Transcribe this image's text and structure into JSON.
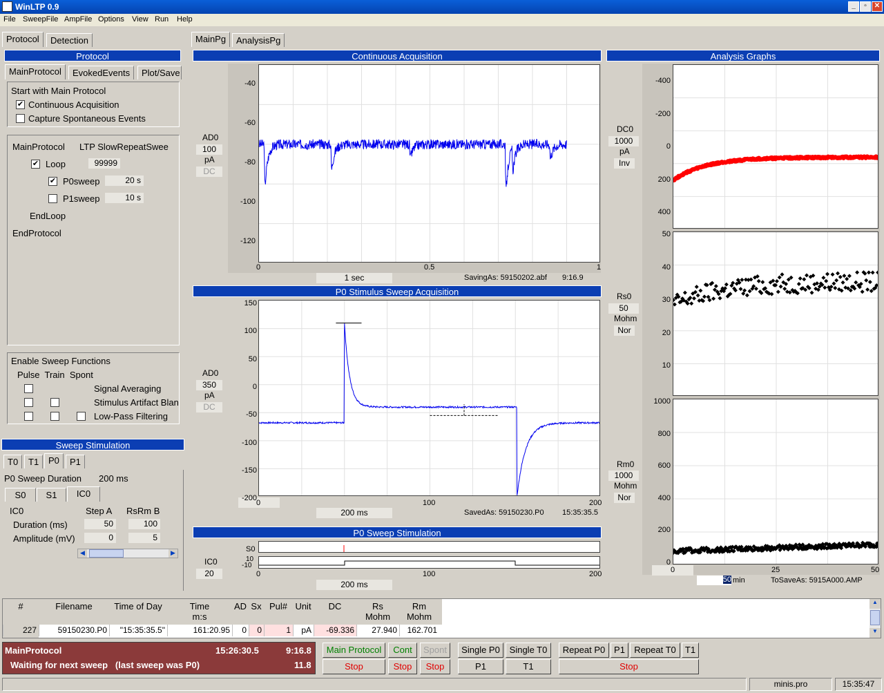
{
  "window": {
    "title": "WinLTP 0.9"
  },
  "menu": [
    "File",
    "SweepFile",
    "AmpFile",
    "Options",
    "View",
    "Run",
    "Help"
  ],
  "left_tabs": [
    "Protocol",
    "Detection"
  ],
  "protocol": {
    "header": "Protocol",
    "subtabs": [
      "MainProtocol",
      "EvokedEvents",
      "Plot/Save"
    ],
    "start_title": "Start with Main Protocol",
    "continuous": "Continuous Acquisition",
    "capture": "Capture Spontaneous Events",
    "main_label": "MainProtocol",
    "main_name": "LTP SlowRepeatSwee",
    "loop": "Loop",
    "loop_count": "99999",
    "p0sweep": "P0sweep",
    "p0_time": "20 s",
    "p1sweep": "P1sweep",
    "p1_time": "10 s",
    "endloop": "EndLoop",
    "endprotocol": "EndProtocol"
  },
  "enable": {
    "title": "Enable Sweep Functions",
    "cols": "Pulse  Train  Spont",
    "rows": [
      "Signal Averaging",
      "Stimulus Artifact Blan",
      "Low-Pass Filtering"
    ]
  },
  "sweep_stim": {
    "header": "Sweep Stimulation",
    "tabs": [
      "T0",
      "T1",
      "P0",
      "P1"
    ],
    "duration_label": "P0 Sweep Duration",
    "duration_val": "200 ms",
    "subtabs": [
      "S0",
      "S1",
      "IC0"
    ],
    "ic0": "IC0",
    "step_a": "Step A",
    "rsrm_b": "RsRm B",
    "dur_label": "Duration (ms)",
    "dur_a": "50",
    "dur_b": "100",
    "amp_label": "Amplitude (mV)",
    "amp_a": "0",
    "amp_b": "5"
  },
  "main_tabs": [
    "MainPg",
    "AnalysisPg"
  ],
  "cont": {
    "header": "Continuous Acquisition",
    "chan": "AD0",
    "scale": "100",
    "unit": "pA",
    "mode": "DC",
    "yticks": [
      "-40",
      "-60",
      "-80",
      "-100",
      "-120"
    ],
    "xticks": [
      "0",
      "0.5",
      "1"
    ],
    "xunit": "1 sec",
    "saving": "SavingAs: 59150202.abf",
    "time": "9:16.9"
  },
  "p0acq": {
    "header": "P0 Stimulus Sweep Acquisition",
    "chan": "AD0",
    "scale": "350",
    "unit": "pA",
    "mode": "DC",
    "yticks": [
      "150",
      "100",
      "50",
      "0",
      "-50",
      "-100",
      "-150",
      "-200"
    ],
    "xticks": [
      "0",
      "100",
      "200"
    ],
    "xunit": "200 ms",
    "saved": "SavedAs: 59150230.P0",
    "time": "15:35:35.5"
  },
  "p0stim": {
    "header": "P0 Sweep Stimulation",
    "s0": "S0",
    "ten": "10",
    "mten": "-10",
    "ic0": "IC0",
    "ic0_val": "20",
    "xticks": [
      "0",
      "100",
      "200"
    ],
    "xunit": "200 ms"
  },
  "analysis": {
    "header": "Analysis Graphs",
    "dc": {
      "chan": "DC0",
      "scale": "1000",
      "unit": "pA",
      "mode": "Inv",
      "yticks": [
        "-400",
        "-200",
        "0",
        "200",
        "400"
      ]
    },
    "rs": {
      "chan": "Rs0",
      "scale": "50",
      "unit": "Mohm",
      "mode": "Nor",
      "yticks": [
        "50",
        "40",
        "30",
        "20",
        "10"
      ]
    },
    "rm": {
      "chan": "Rm0",
      "scale": "1000",
      "unit": "Mohm",
      "mode": "Nor",
      "yticks": [
        "1000",
        "800",
        "600",
        "400",
        "200",
        "0"
      ]
    },
    "xticks": [
      "0",
      "25",
      "50"
    ],
    "xval": "50",
    "xunit": "min",
    "tosave": "ToSaveAs: 5915A000.AMP"
  },
  "table": {
    "headers": [
      [
        "#",
        ""
      ],
      [
        "Filename",
        ""
      ],
      [
        "Time of Day",
        ""
      ],
      [
        "Time",
        "m:s"
      ],
      [
        "AD",
        ""
      ],
      [
        "Sx",
        ""
      ],
      [
        "Pul#",
        ""
      ],
      [
        "Unit",
        ""
      ],
      [
        "DC",
        ""
      ],
      [
        "Rs",
        "Mohm"
      ],
      [
        "Rm",
        "Mohm"
      ]
    ],
    "row": [
      "227",
      "59150230.P0",
      "\"15:35:35.5\"",
      "161:20.95",
      "0",
      "0",
      "1",
      "pA",
      "-69.336",
      "27.940",
      "162.701"
    ]
  },
  "status": {
    "proto": "MainProtocol",
    "clock": "15:26:30.5",
    "elapsed": "9:16.8",
    "waiting": "Waiting for next sweep   (last sweep was P0)",
    "count": "11.8"
  },
  "buttons": {
    "main_protocol": "Main Protocol",
    "cont": "Cont",
    "spont": "Spont",
    "stop": "Stop",
    "single_p0": "Single P0",
    "single_t0": "Single T0",
    "p1": "P1",
    "t1": "T1",
    "repeat_p0": "Repeat P0",
    "repeat_t0": "Repeat T0"
  },
  "statusbar": {
    "file": "minis.pro",
    "time": "15:35:47"
  },
  "colors": {
    "trace": "#0000ee",
    "dc_trace": "#ff0000",
    "header": "#0b3eb3",
    "status_bg": "#8b3a3a"
  },
  "chart_data": [
    {
      "type": "line",
      "name": "Continuous Acquisition",
      "xlim": [
        0,
        1
      ],
      "ylim": [
        -130,
        -30
      ],
      "x": [
        0,
        0.02,
        0.05,
        0.2,
        0.21,
        0.3,
        0.45,
        0.6,
        0.72,
        0.73,
        0.75,
        0.85,
        0.9
      ],
      "y": [
        -70,
        -100,
        -72,
        -70,
        -88,
        -70,
        -80,
        -70,
        -100,
        -80,
        -72,
        -70,
        -70
      ]
    },
    {
      "type": "line",
      "name": "P0 Stimulus Sweep Acquisition",
      "xlim": [
        0,
        200
      ],
      "ylim": [
        -200,
        150
      ],
      "x": [
        0,
        50,
        52,
        60,
        80,
        150,
        152,
        160,
        200
      ],
      "y": [
        -68,
        -68,
        110,
        -30,
        -38,
        -40,
        -200,
        -90,
        -65
      ]
    },
    {
      "type": "scatter",
      "name": "DC0",
      "xlim": [
        0,
        50
      ],
      "ylim": [
        -450,
        450
      ],
      "x": [
        0,
        5,
        15,
        25,
        35,
        45,
        50
      ],
      "y": [
        -180,
        -120,
        -90,
        -60,
        -40,
        -50,
        -55
      ]
    },
    {
      "type": "scatter",
      "name": "Rs0",
      "xlim": [
        0,
        50
      ],
      "ylim": [
        0,
        50
      ],
      "x": [
        0,
        5,
        10,
        15,
        20,
        25,
        30,
        35,
        40,
        45,
        50
      ],
      "y": [
        28,
        30,
        32,
        33,
        34,
        33,
        34,
        35,
        36,
        34,
        36
      ]
    },
    {
      "type": "scatter",
      "name": "Rm0",
      "xlim": [
        0,
        50
      ],
      "ylim": [
        0,
        1000
      ],
      "x": [
        0,
        10,
        20,
        30,
        40,
        50
      ],
      "y": [
        80,
        100,
        110,
        115,
        120,
        125
      ]
    }
  ]
}
